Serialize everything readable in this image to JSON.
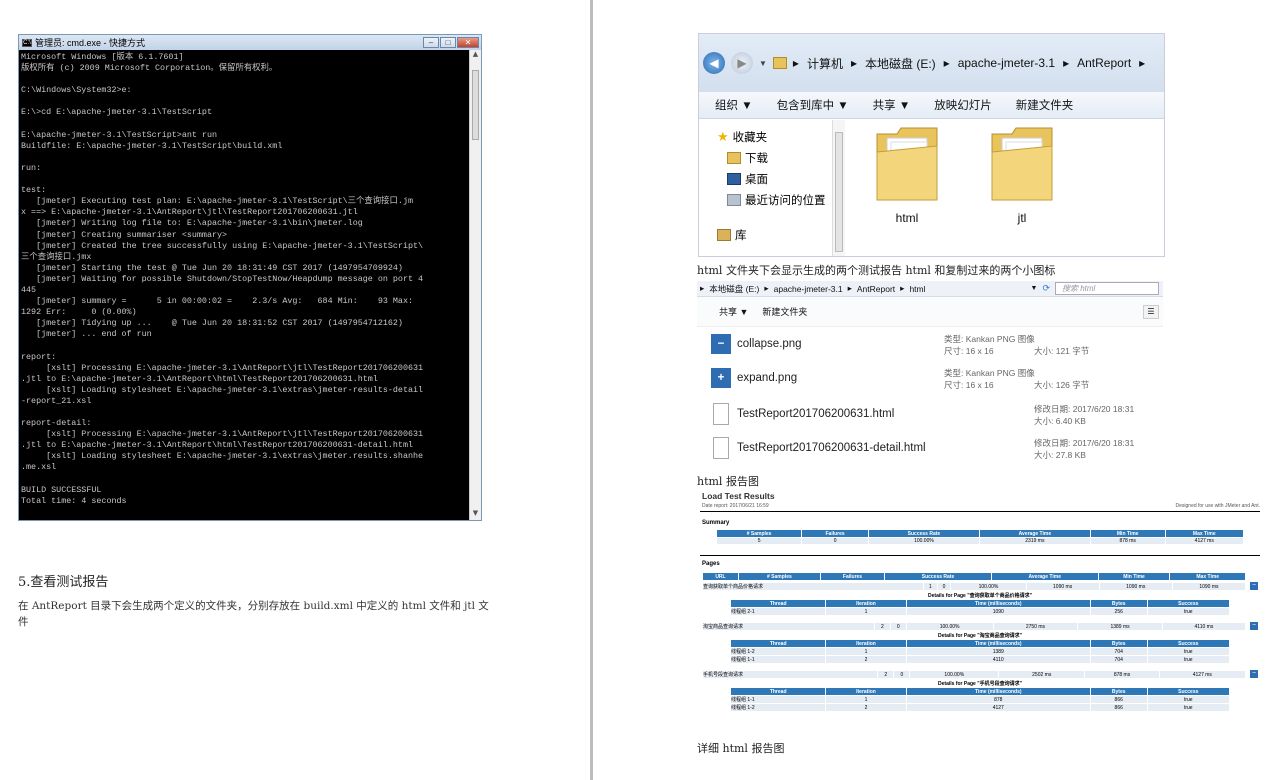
{
  "cmd": {
    "title": "管理员: cmd.exe - 快捷方式",
    "icon": "cmd-icon",
    "lines": [
      "Microsoft Windows [版本 6.1.7601]",
      "版权所有 (c) 2009 Microsoft Corporation。保留所有权利。",
      "",
      "C:\\Windows\\System32>e:",
      "",
      "E:\\>cd E:\\apache-jmeter-3.1\\TestScript",
      "",
      "E:\\apache-jmeter-3.1\\TestScript>ant run",
      "Buildfile: E:\\apache-jmeter-3.1\\TestScript\\build.xml",
      "",
      "run:",
      "",
      "test:",
      "   [jmeter] Executing test plan: E:\\apache-jmeter-3.1\\TestScript\\三个查询接口.jm",
      "x ==> E:\\apache-jmeter-3.1\\AntReport\\jtl\\TestReport201706200631.jtl",
      "   [jmeter] Writing log file to: E:\\apache-jmeter-3.1\\bin\\jmeter.log",
      "   [jmeter] Creating summariser <summary>",
      "   [jmeter] Created the tree successfully using E:\\apache-jmeter-3.1\\TestScript\\",
      "三个查询接口.jmx",
      "   [jmeter] Starting the test @ Tue Jun 20 18:31:49 CST 2017 (1497954709924)",
      "   [jmeter] Waiting for possible Shutdown/StopTestNow/Heapdump message on port 4",
      "445",
      "   [jmeter] summary =      5 in 00:00:02 =    2.3/s Avg:   684 Min:    93 Max:",
      "1292 Err:     0 (0.00%)",
      "   [jmeter] Tidying up ...    @ Tue Jun 20 18:31:52 CST 2017 (1497954712162)",
      "   [jmeter] ... end of run",
      "",
      "report:",
      "     [xslt] Processing E:\\apache-jmeter-3.1\\AntReport\\jtl\\TestReport201706200631",
      ".jtl to E:\\apache-jmeter-3.1\\AntReport\\html\\TestReport201706200631.html",
      "     [xslt] Loading stylesheet E:\\apache-jmeter-3.1\\extras\\jmeter-results-detail",
      "-report_21.xsl",
      "",
      "report-detail:",
      "     [xslt] Processing E:\\apache-jmeter-3.1\\AntReport\\jtl\\TestReport201706200631",
      ".jtl to E:\\apache-jmeter-3.1\\AntReport\\html\\TestReport201706200631-detail.html",
      "     [xslt] Loading stylesheet E:\\apache-jmeter-3.1\\extras\\jmeter.results.shanhe",
      ".me.xsl",
      "",
      "BUILD SUCCESSFUL",
      "Total time: 4 seconds"
    ]
  },
  "section": {
    "title": "5.查看测试报告",
    "para": "在 AntReport 目录下会生成两个定义的文件夹，分别存放在 build.xml 中定义的 html 文件和 jtl 文件"
  },
  "explorer1": {
    "crumbs": [
      "计算机",
      "本地磁盘 (E:)",
      "apache-jmeter-3.1",
      "AntReport"
    ],
    "toolbar": [
      "组织 ▼",
      "包含到库中 ▼",
      "共享 ▼",
      "放映幻灯片",
      "新建文件夹"
    ],
    "nav": [
      "收藏夹",
      "下载",
      "桌面",
      "最近访问的位置",
      "库"
    ],
    "folders": [
      "html",
      "jtl"
    ]
  },
  "caption1": "html 文件夹下会显示生成的两个测试报告 html 和复制过来的两个小图标",
  "explorer2": {
    "crumbs": [
      "本地磁盘 (E:)",
      "apache-jmeter-3.1",
      "AntReport",
      "html"
    ],
    "search_placeholder": "搜索 html",
    "toolbar": [
      "共享 ▼",
      "新建文件夹"
    ],
    "files": [
      {
        "name": "collapse.png",
        "meta1": "类型: Kankan PNG 图像",
        "meta2": "尺寸: 16 x 16",
        "meta3": "大小: 121 字节"
      },
      {
        "name": "expand.png",
        "meta1": "类型: Kankan PNG 图像",
        "meta2": "尺寸: 16 x 16",
        "meta3": "大小: 126 字节"
      },
      {
        "name": "TestReport201706200631.html",
        "meta1": "修改日期: 2017/6/20 18:31",
        "meta2": "大小: 6.40 KB"
      },
      {
        "name": "TestReport201706200631-detail.html",
        "meta1": "修改日期: 2017/6/20 18:31",
        "meta2": "大小: 27.8 KB"
      }
    ]
  },
  "caption2": "html 报告图",
  "report": {
    "title": "Load Test Results",
    "date": "Date report: 2017/06/21 16:59",
    "designed": "Designed for use with JMeter and Ant.",
    "summary_label": "Summary",
    "summary_headers": [
      "# Samples",
      "Failures",
      "Success Rate",
      "Average Time",
      "Min Time",
      "Max Time"
    ],
    "summary_row": [
      "5",
      "0",
      "100.00%",
      "2319 ms",
      "878 ms",
      "4127 ms"
    ],
    "pages_label": "Pages",
    "pages_headers": [
      "URL",
      "# Samples",
      "Failures",
      "Success Rate",
      "Average Time",
      "Min Time",
      "Max Time"
    ],
    "detail_headers": [
      "Thread",
      "Iteration",
      "Time (milliseconds)",
      "Bytes",
      "Success"
    ],
    "pages": [
      {
        "row": [
          "查询获取单个商品价格请求",
          "1",
          "0",
          "100.00%",
          "1090 ms",
          "1090 ms",
          "1090 ms"
        ],
        "detail_title": "Details for Page \"查询获取单个商品价格请求\"",
        "details": [
          [
            "线程组 2-1",
            "1",
            "1090",
            "256",
            "true"
          ]
        ]
      },
      {
        "row": [
          "淘宝商品查询请求",
          "2",
          "0",
          "100.00%",
          "2750 ms",
          "1389 ms",
          "4110 ms"
        ],
        "detail_title": "Details for Page \"淘宝商品查询请求\"",
        "details": [
          [
            "线程组 1-2",
            "1",
            "1389",
            "704",
            "true"
          ],
          [
            "线程组 1-1",
            "2",
            "4110",
            "704",
            "true"
          ]
        ]
      },
      {
        "row": [
          "手机号段查询请求",
          "2",
          "0",
          "100.00%",
          "2502 ms",
          "878 ms",
          "4127 ms"
        ],
        "detail_title": "Details for Page \"手机号段查询请求\"",
        "details": [
          [
            "线程组 1-1",
            "1",
            "878",
            "866",
            "true"
          ],
          [
            "线程组 1-2",
            "2",
            "4127",
            "866",
            "true"
          ]
        ]
      }
    ]
  },
  "caption3": "详细 html 报告图"
}
